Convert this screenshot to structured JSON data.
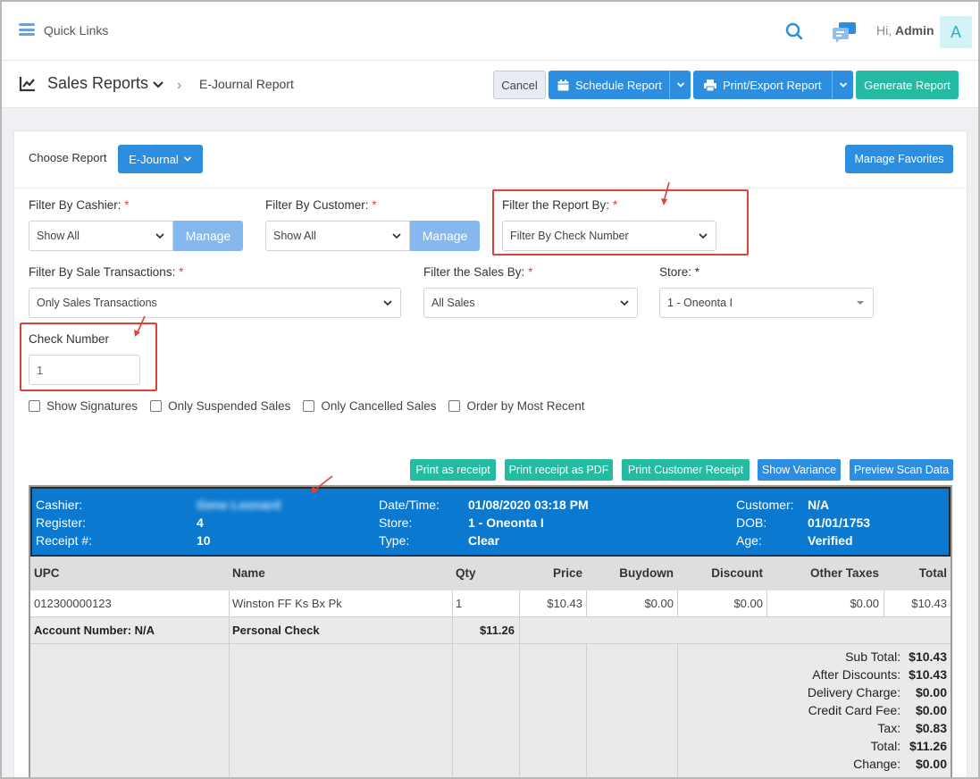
{
  "header": {
    "quick_links": "Quick Links",
    "greeting": "Hi,",
    "user": "Admin",
    "avatar_letter": "A"
  },
  "subbar": {
    "title": "Sales Reports",
    "breadcrumb": "E-Journal Report",
    "cancel": "Cancel",
    "schedule": "Schedule Report",
    "print_export": "Print/Export Report",
    "generate": "Generate Report"
  },
  "panel": {
    "choose_report": "Choose Report",
    "report_select": "E-Journal",
    "manage_favorites": "Manage Favorites",
    "filter_cashier_label": "Filter By Cashier:",
    "filter_cashier_value": "Show All",
    "filter_customer_label": "Filter By Customer:",
    "filter_customer_value": "Show All",
    "manage": "Manage",
    "filter_report_label": "Filter the Report By:",
    "filter_report_value": "Filter By Check Number",
    "filter_sale_tx_label": "Filter By Sale Transactions:",
    "filter_sale_tx_value": "Only Sales Transactions",
    "filter_sales_label": "Filter the Sales By:",
    "filter_sales_value": "All Sales",
    "store_label": "Store: *",
    "store_value": "1 - Oneonta I",
    "check_number_label": "Check Number",
    "check_number_value": "1",
    "required_mark": "*",
    "checkboxes": [
      "Show Signatures",
      "Only Suspended Sales",
      "Only Cancelled Sales",
      "Order by Most Recent"
    ]
  },
  "actions": {
    "print_receipt": "Print as receipt",
    "print_pdf": "Print receipt as PDF",
    "print_customer": "Print Customer Receipt",
    "show_variance": "Show Variance",
    "preview_scan": "Preview Scan Data"
  },
  "receipt": {
    "cashier_label": "Cashier:",
    "cashier_value": "Gene Leonard",
    "register_label": "Register:",
    "register_value": "4",
    "receipt_label": "Receipt #:",
    "receipt_value": "10",
    "datetime_label": "Date/Time:",
    "datetime_value": "01/08/2020 03:18 PM",
    "store_label": "Store:",
    "store_value": "1 - Oneonta I",
    "type_label": "Type:",
    "type_value": "Clear",
    "customer_label": "Customer:",
    "customer_value": "N/A",
    "dob_label": "DOB:",
    "dob_value": "01/01/1753",
    "age_label": "Age:",
    "age_value": "Verified",
    "columns": [
      "UPC",
      "Name",
      "Qty",
      "Price",
      "Buydown",
      "Discount",
      "Other Taxes",
      "Total"
    ],
    "item": {
      "upc": "012300000123",
      "name": "Winston FF Ks Bx Pk",
      "qty": "1",
      "price": "$10.43",
      "buydown": "$0.00",
      "discount": "$0.00",
      "other_taxes": "$0.00",
      "total": "$10.43"
    },
    "payment": {
      "account": "Account Number: N/A",
      "method": "Personal Check",
      "amount": "$11.26"
    },
    "totals": [
      {
        "label": "Sub Total:",
        "value": "$10.43"
      },
      {
        "label": "After Discounts:",
        "value": "$10.43"
      },
      {
        "label": "Delivery Charge:",
        "value": "$0.00"
      },
      {
        "label": "Credit Card Fee:",
        "value": "$0.00"
      },
      {
        "label": "Tax:",
        "value": "$0.83"
      },
      {
        "label": "Total:",
        "value": "$11.26"
      },
      {
        "label": "Change:",
        "value": "$0.00"
      }
    ]
  },
  "colors": {
    "primary": "#2d8ee0",
    "success": "#25bba2",
    "receipt_header": "#0b79d0",
    "highlight": "#e0413b"
  }
}
